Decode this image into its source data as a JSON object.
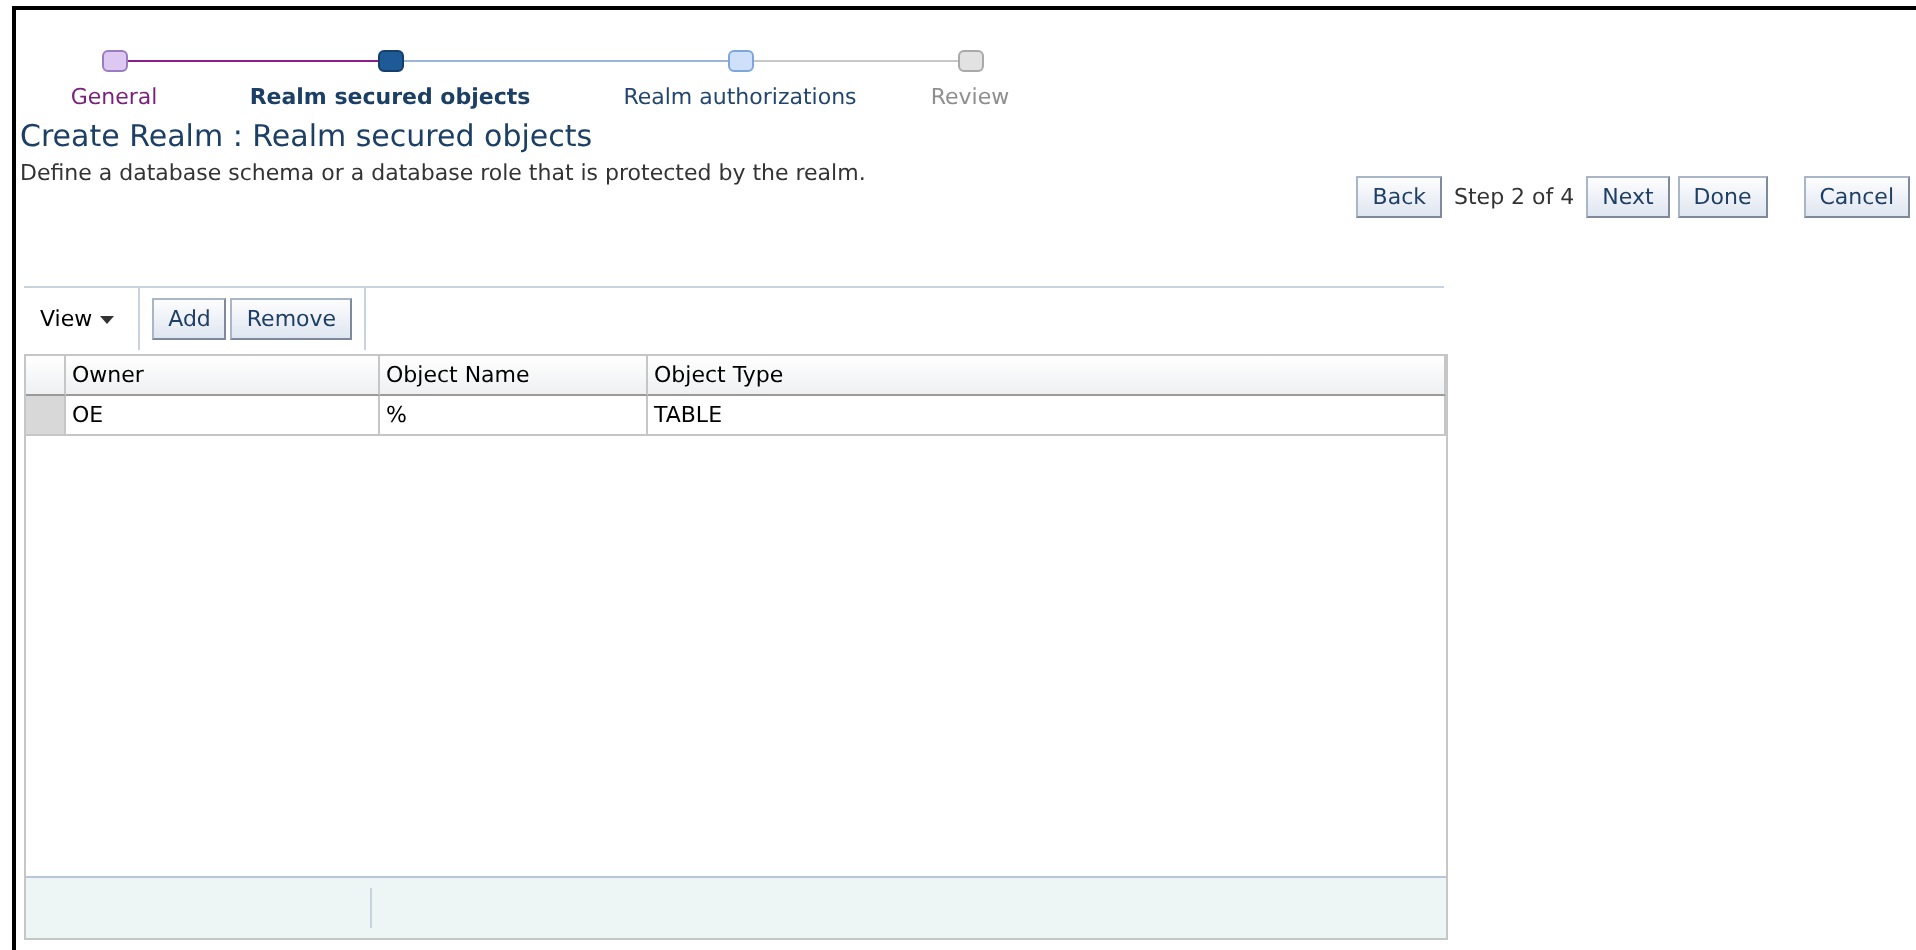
{
  "train": [
    {
      "label": "General",
      "visited": true,
      "selected": false,
      "disabled": false
    },
    {
      "label": "Realm secured objects",
      "visited": false,
      "selected": true,
      "disabled": false
    },
    {
      "label": "Realm authorizations",
      "visited": false,
      "selected": false,
      "disabled": false
    },
    {
      "label": "Review",
      "visited": false,
      "selected": false,
      "disabled": true
    }
  ],
  "title": "Create Realm : Realm secured objects",
  "description": "Define a database schema or a database role that is protected by the realm.",
  "navigation": {
    "back": "Back",
    "step": "Step 2 of 4",
    "next": "Next",
    "done": "Done",
    "cancel": "Cancel"
  },
  "toolbar": {
    "view_menu": "View",
    "add": "Add",
    "remove": "Remove"
  },
  "table": {
    "columns": [
      "Owner",
      "Object Name",
      "Object Type"
    ],
    "rows": [
      [
        "OE",
        "%",
        "TABLE"
      ]
    ]
  }
}
